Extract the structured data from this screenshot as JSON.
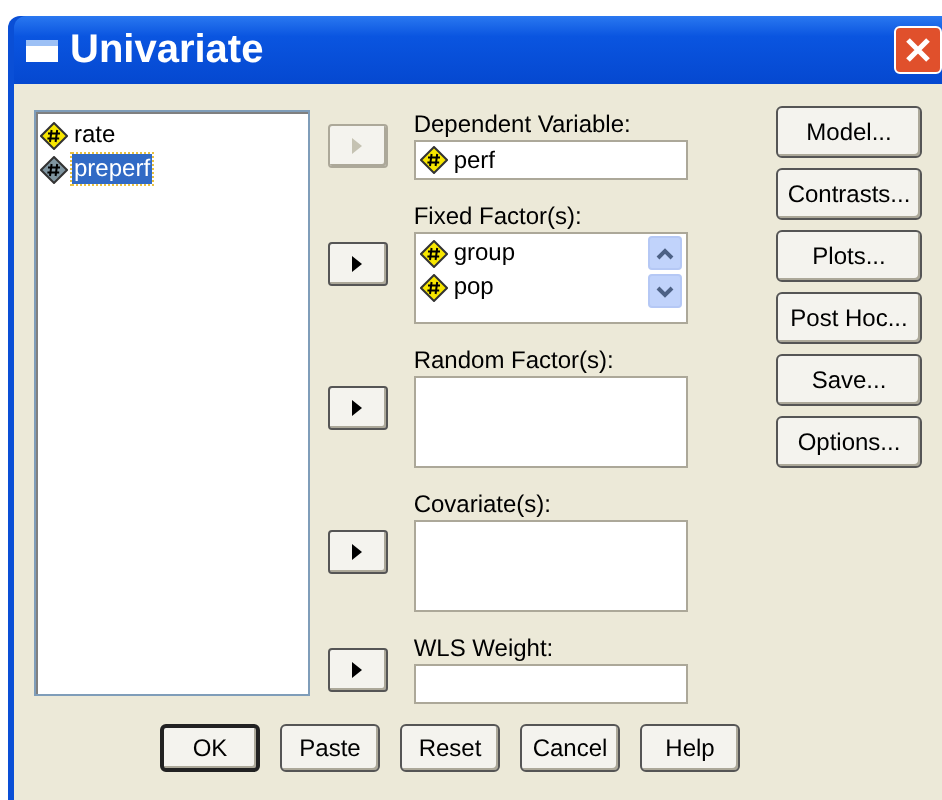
{
  "window": {
    "title": "Univariate"
  },
  "variables": [
    {
      "name": "rate",
      "selected": false
    },
    {
      "name": "preperf",
      "selected": true
    }
  ],
  "targets": [
    {
      "kind": "field",
      "label": "Dependent Variable:",
      "arrow_disabled": true,
      "items": [
        {
          "name": "perf"
        }
      ]
    },
    {
      "kind": "list",
      "label": "Fixed Factor(s):",
      "arrow_disabled": false,
      "items": [
        {
          "name": "group"
        },
        {
          "name": "pop"
        }
      ]
    },
    {
      "kind": "list",
      "label": "Random Factor(s):",
      "arrow_disabled": false
    },
    {
      "kind": "list",
      "label": "Covariate(s):",
      "arrow_disabled": false
    },
    {
      "kind": "field",
      "label": "WLS Weight:",
      "arrow_disabled": false
    }
  ],
  "side_buttons": [
    "Model...",
    "Contrasts...",
    "Plots...",
    "Post Hoc...",
    "Save...",
    "Options..."
  ],
  "bottom_buttons": [
    {
      "label": "OK",
      "default": true
    },
    {
      "label": "Paste",
      "default": false
    },
    {
      "label": "Reset",
      "default": false
    },
    {
      "label": "Cancel",
      "default": false
    },
    {
      "label": "Help",
      "default": false
    }
  ]
}
